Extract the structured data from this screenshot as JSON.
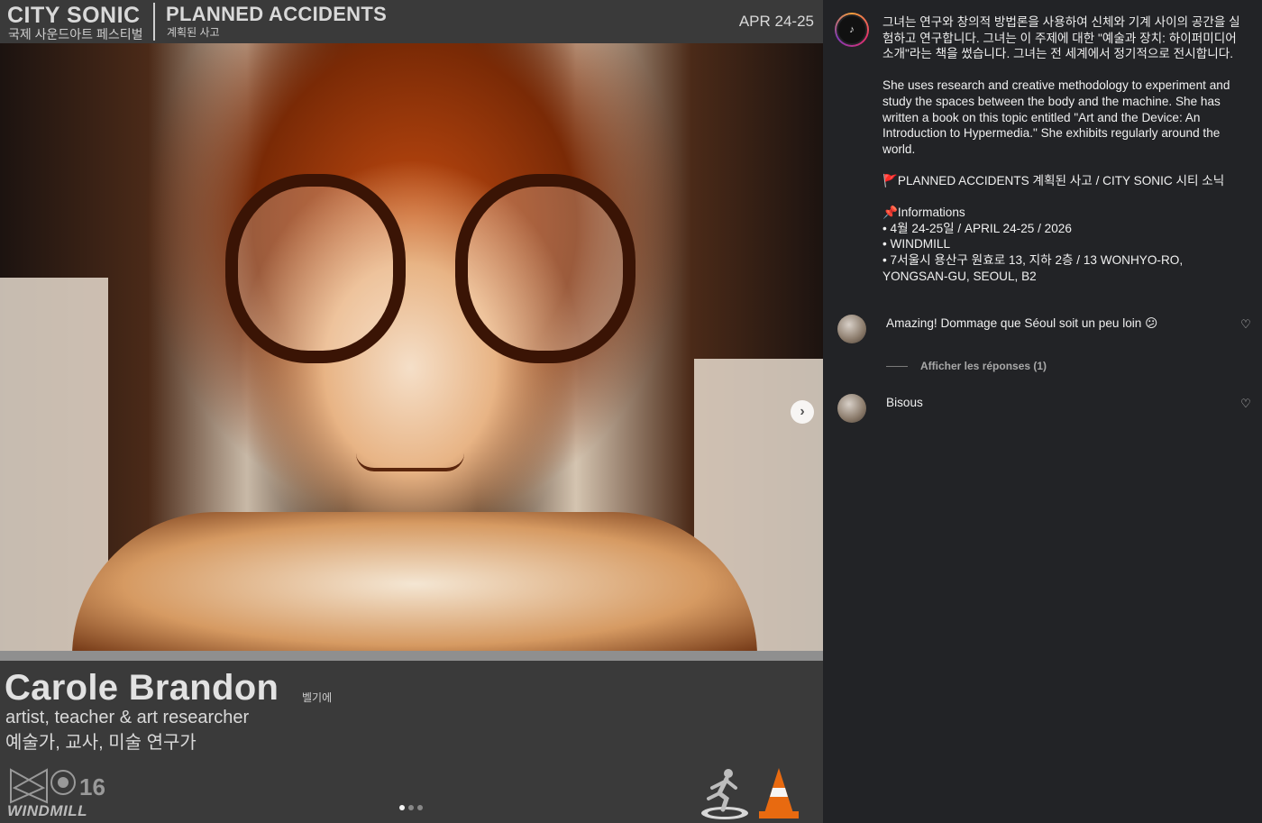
{
  "poster": {
    "brand": "CITY SONIC",
    "brand_sub": "국제 사운드아트 페스티벌",
    "event_title": "PLANNED ACCIDENTS",
    "event_sub": "계획된 사고",
    "date": "APR 24-25",
    "person_name": "Carole Brandon",
    "person_origin": "벨기에",
    "role_en": "artist, teacher & art researcher",
    "role_ko": "예술가, 교사, 미술 연구가",
    "footer_logo": "WINDMILL",
    "next_arrow": "›"
  },
  "carousel": {
    "count": 3,
    "active": 1
  },
  "caption": {
    "ko": "그녀는 연구와 창의적 방법론을 사용하여 신체와 기계 사이의 공간을 실험하고 연구합니다. 그녀는 이 주제에 대한 \"예술과 장치: 하이퍼미디어 소개\"라는 책을 썼습니다. 그녀는 전 세계에서 정기적으로 전시합니다.",
    "en": "She uses research and creative methodology to experiment and study the spaces between the body and the machine. She has written a book on this topic entitled \"Art and the Device: An Introduction to Hypermedia.\" She exhibits regularly around the world.",
    "event_line": "🚩PLANNED ACCIDENTS 계획된 사고 / CITY SONIC 시티 소닉",
    "info_title": "📌Informations",
    "info_date": "• 4월 24-25일 / APRIL 24-25 / 2026",
    "info_venue": "• WINDMILL",
    "info_address": "• 7서울시 용산구 원효로 13, 지하 2층 / 13 WONHYO-RO, YONGSAN-GU, SEOUL, B2"
  },
  "comments": [
    {
      "text": "Amazing! Dommage que Séoul soit un peu loin 😕",
      "like_icon": "heart-outline-icon"
    },
    {
      "text": "Bisous",
      "like_icon": "heart-outline-icon"
    }
  ],
  "replies_toggle": "Afficher les réponses (1)",
  "colors": {
    "accent_orange": "#e86a10",
    "panel_bg": "#222326",
    "poster_bg": "#3a3a3a"
  }
}
